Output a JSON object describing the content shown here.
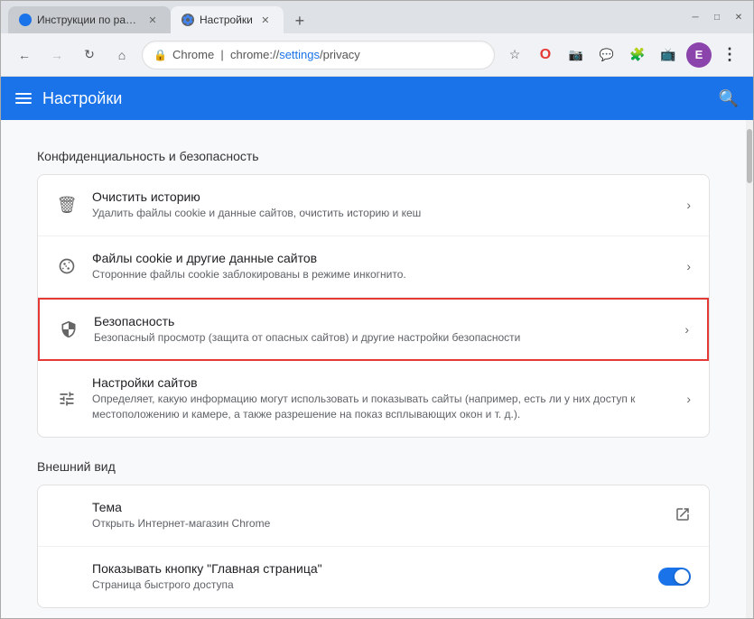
{
  "browser": {
    "tabs": [
      {
        "id": "tab1",
        "title": "Инструкции по работе с комп...",
        "favicon_type": "blue",
        "active": false
      },
      {
        "id": "tab2",
        "title": "Настройки",
        "favicon_type": "gear",
        "active": true
      }
    ],
    "new_tab_label": "+",
    "window_controls": {
      "minimize": "─",
      "maximize": "□",
      "close": "✕"
    }
  },
  "address_bar": {
    "back_disabled": false,
    "forward_disabled": true,
    "refresh_icon": "↻",
    "home_icon": "⌂",
    "address_pre": "Chrome  |  chrome://",
    "address_main": "settings",
    "address_post": "/privacy",
    "star_icon": "☆",
    "brand_name": "Chrome"
  },
  "header": {
    "title": "Настройки",
    "search_icon": "🔍"
  },
  "sections": [
    {
      "id": "privacy",
      "title": "Конфиденциальность и безопасность",
      "items": [
        {
          "id": "clear-history",
          "icon": "🗑",
          "title": "Очистить историю",
          "desc": "Удалить файлы cookie и данные сайтов, очистить историю и кеш",
          "action": "chevron",
          "highlighted": false
        },
        {
          "id": "cookies",
          "icon": "🍪",
          "title": "Файлы cookie и другие данные сайтов",
          "desc": "Сторонние файлы cookie заблокированы в режиме инкогнито.",
          "action": "chevron",
          "highlighted": false
        },
        {
          "id": "security",
          "icon": "🛡",
          "title": "Безопасность",
          "desc": "Безопасный просмотр (защита от опасных сайтов) и другие настройки безопасности",
          "action": "chevron",
          "highlighted": true
        },
        {
          "id": "site-settings",
          "icon": "⚙",
          "title": "Настройки сайтов",
          "desc": "Определяет, какую информацию могут использовать и показывать сайты (например, есть ли у них доступ к местоположению и камере, а также разрешение на показ всплывающих окон и т. д.).",
          "action": "chevron",
          "highlighted": false
        }
      ]
    },
    {
      "id": "appearance",
      "title": "Внешний вид",
      "items": [
        {
          "id": "theme",
          "icon": "",
          "title": "Тема",
          "desc": "Открыть Интернет-магазин Chrome",
          "action": "external",
          "highlighted": false
        },
        {
          "id": "home-button",
          "icon": "",
          "title": "Показывать кнопку \"Главная страница\"",
          "desc": "Страница быстрого доступа",
          "action": "toggle",
          "toggle_on": true,
          "highlighted": false
        }
      ]
    }
  ]
}
